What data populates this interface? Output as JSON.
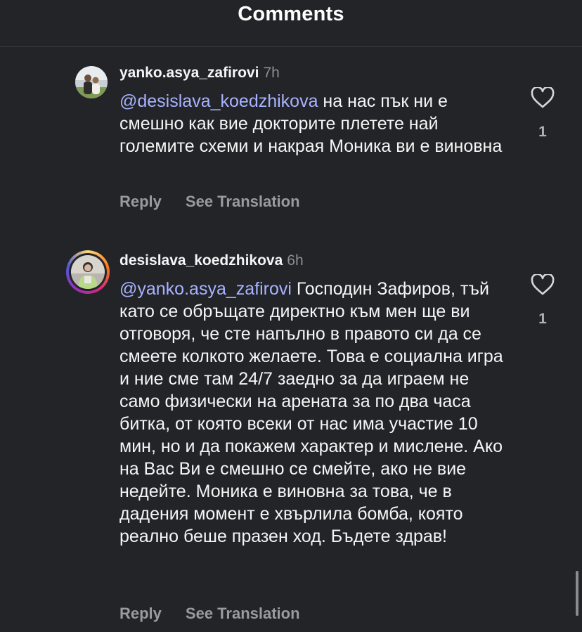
{
  "header": {
    "title": "Comments"
  },
  "comments": [
    {
      "username": "yanko.asya_zafirovi",
      "time": "7h",
      "mention": "@desislava_koedzhikova",
      "text": " на нас пък ни е смешно как вие докторите плетете най големите схеми и накрая Моника ви е виновна",
      "like_count": "1",
      "reply_label": "Reply",
      "translate_label": "See Translation"
    },
    {
      "username": "desislava_koedzhikova",
      "time": "6h",
      "mention": "@yanko.asya_zafirovi",
      "text": " Господин Зафиров, тъй като се обръщате директно към мен ще ви отговоря, че сте напълно в правото си да се смеете колкото желаете. Това е социална игра и ние сме там 24/7 заедно за да играем не само физически на арената за по два часа битка, от която всеки от нас има участие 10 мин, но и да покажем характер и мислене. Ако на Вас Ви е смешно се смейте, ако не вие недейте. Моника е виновна за това, че в дадения момент е хвърлила бомба, която реално беше празен ход. Бъдете здрав!",
      "like_count": "1",
      "reply_label": "Reply",
      "translate_label": "See Translation"
    }
  ],
  "icons": {
    "like": "heart-outline-icon"
  },
  "colors": {
    "background": "#232428",
    "mention": "#a7b3ff",
    "secondary_text": "#9a9aa0"
  }
}
